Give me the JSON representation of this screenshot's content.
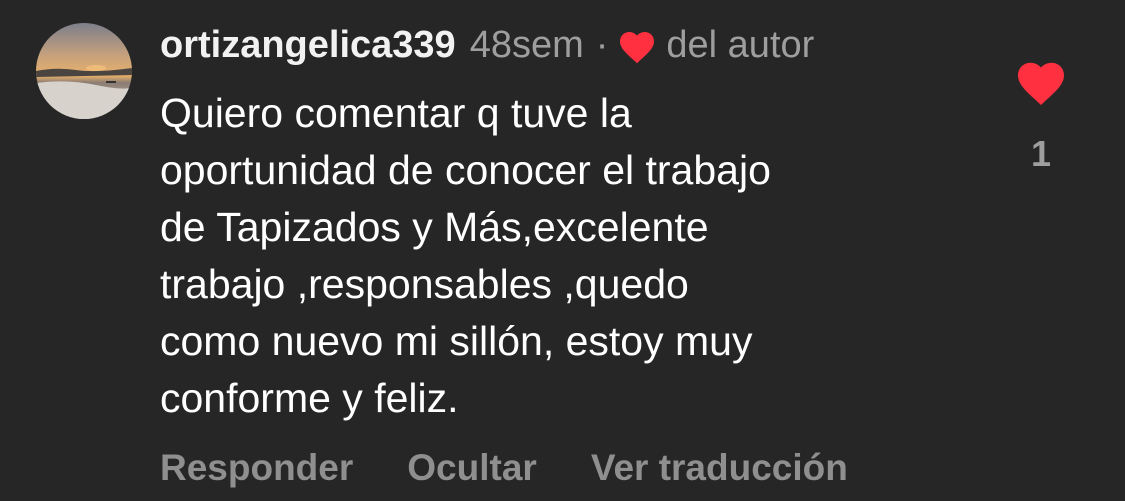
{
  "comment": {
    "username": "ortizangelica339",
    "time": "48sem",
    "separator": "·",
    "author_like_label": "del autor",
    "text_lines": [
      "Quiero comentar q tuve la",
      "oportunidad de conocer el trabajo",
      "de Tapizados y Más,excelente",
      "trabajo ,responsables ,quedo",
      "como nuevo mi sillón, estoy muy",
      "conforme y feliz."
    ],
    "like_count": "1",
    "actions": {
      "reply": "Responder",
      "hide": "Ocultar",
      "translate": "Ver traducción"
    }
  },
  "icons": {
    "author_heart": "heart-icon",
    "like": "heart-filled-icon",
    "avatar": "beach-sunset-photo"
  },
  "colors": {
    "background": "#262626",
    "heart": "#ff3040",
    "primary_text": "#ffffff",
    "secondary_text": "#9e9e9e"
  }
}
